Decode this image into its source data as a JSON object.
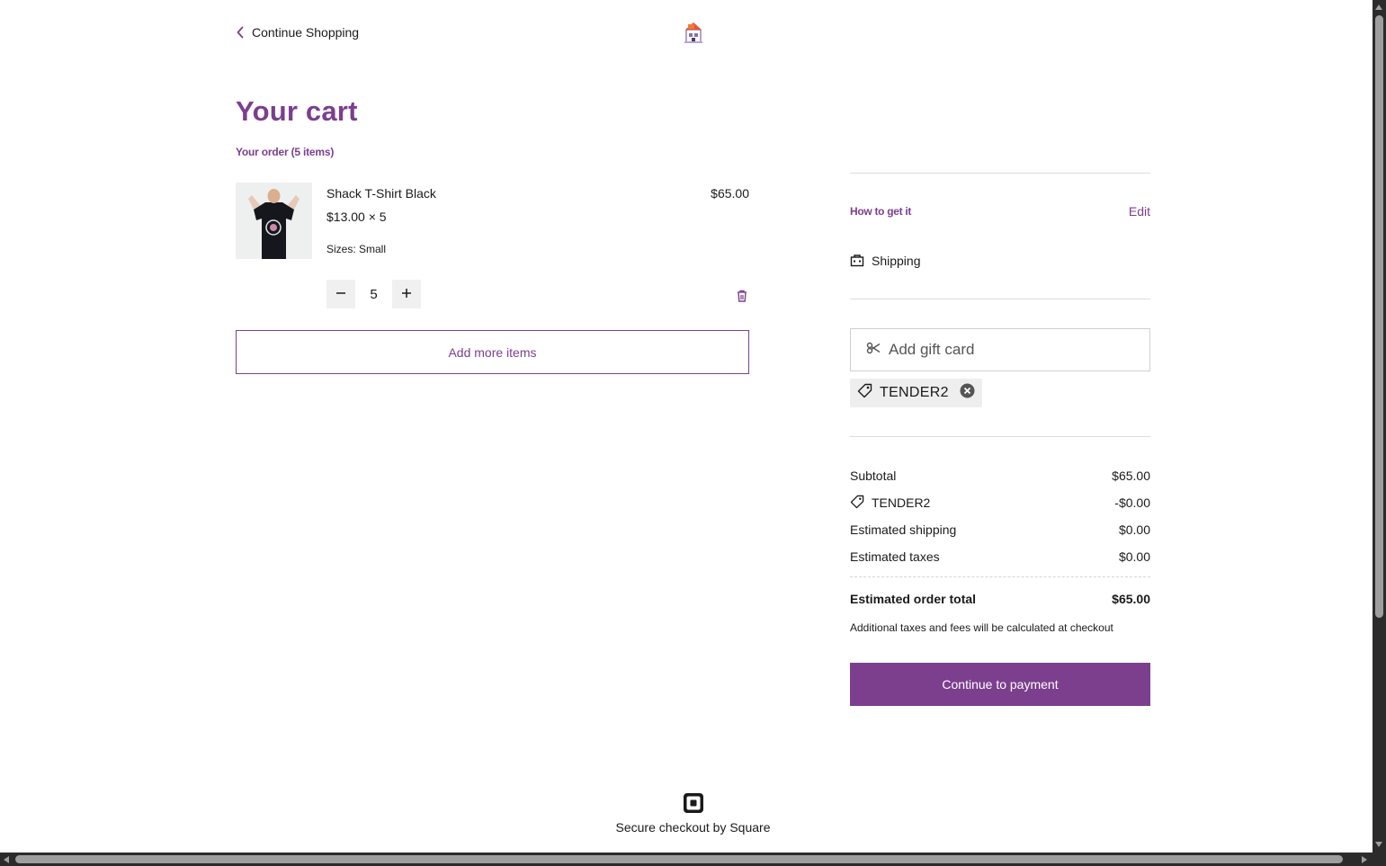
{
  "header": {
    "back_label": "Continue Shopping",
    "back_icon": "chevron-left-icon",
    "logo_icon": "store-logo"
  },
  "cart": {
    "title": "Your cart",
    "order_count": "Your order (5 items)",
    "items": [
      {
        "name": "Shack T-Shirt Black",
        "unit_price_line": "$13.00 × 5",
        "option": "Sizes: Small",
        "line_total": "$65.00",
        "quantity": "5"
      }
    ],
    "add_more_label": "Add more items"
  },
  "fulfillment": {
    "label": "How to get it",
    "edit_label": "Edit",
    "method": "Shipping",
    "method_icon": "shop-bag-icon"
  },
  "gift": {
    "add_gift_card_label": "Add gift card",
    "applied_code": "TENDER2"
  },
  "summary": {
    "subtotal_label": "Subtotal",
    "subtotal_value": "$65.00",
    "discount_label": "TENDER2",
    "discount_value": "-$0.00",
    "shipping_label": "Estimated shipping",
    "shipping_value": "$0.00",
    "taxes_label": "Estimated taxes",
    "taxes_value": "$0.00",
    "total_label": "Estimated order total",
    "total_value": "$65.00",
    "note": "Additional taxes and fees will be calculated at checkout",
    "pay_label": "Continue to payment"
  },
  "footer": {
    "secure_text": "Secure checkout by Square",
    "logo_icon": "square-logo-icon"
  },
  "colors": {
    "accent": "#7b3f8e",
    "chip_bg": "#eeeeee",
    "divider": "#dcdcdc"
  }
}
